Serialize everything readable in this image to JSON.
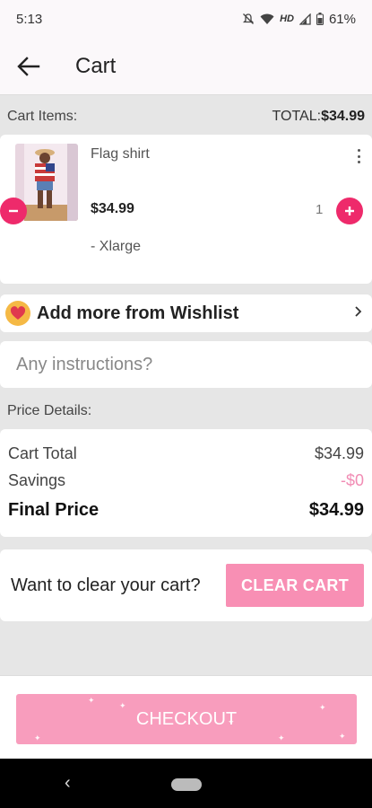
{
  "status": {
    "time": "5:13",
    "network": "HD",
    "battery": "61%"
  },
  "appbar": {
    "title": "Cart"
  },
  "cart": {
    "items_label": "Cart Items:",
    "total_prefix": "TOTAL:",
    "total_value": "$34.99",
    "item": {
      "name": "Flag shirt",
      "price": "$34.99",
      "size": "- Xlarge",
      "quantity": "1"
    }
  },
  "wishlist": {
    "label": "Add more from Wishlist"
  },
  "instructions": {
    "placeholder": "Any instructions?"
  },
  "price": {
    "label": "Price Details:",
    "cart_total_label": "Cart Total",
    "cart_total_value": "$34.99",
    "savings_label": "Savings",
    "savings_value": "-$0",
    "final_label": "Final Price",
    "final_value": "$34.99"
  },
  "clear": {
    "question": "Want to clear your cart?",
    "button": "CLEAR CART"
  },
  "checkout": {
    "button": "CHECKOUT"
  },
  "colors": {
    "accent": "#ee2a6b",
    "button_pink": "#f88fb4",
    "wishlist_icon": "#f5b945"
  },
  "icons": [
    "mute-icon",
    "wifi-icon",
    "signal-icon",
    "battery-icon",
    "back-arrow-icon",
    "more-vert-icon",
    "minus-icon",
    "plus-icon",
    "heart-icon",
    "chevron-right-icon"
  ]
}
